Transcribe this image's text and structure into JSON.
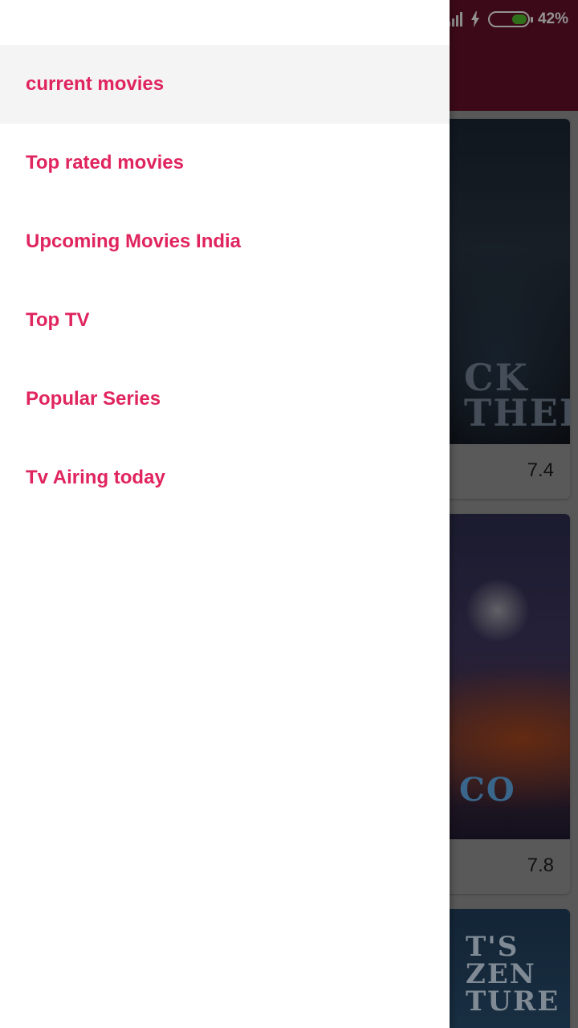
{
  "status_bar": {
    "battery_text": "42%",
    "battery_level": 0.42,
    "icons": [
      "signal-icon",
      "charging-icon",
      "battery-icon"
    ]
  },
  "drawer": {
    "items": [
      {
        "label": "current movies",
        "selected": true
      },
      {
        "label": "Top rated movies",
        "selected": false
      },
      {
        "label": "Upcoming Movies India",
        "selected": false
      },
      {
        "label": "Top TV",
        "selected": false
      },
      {
        "label": "Popular Series",
        "selected": false
      },
      {
        "label": "Tv Airing today",
        "selected": false
      }
    ]
  },
  "content": {
    "cards": [
      {
        "poster_text": "CK\nTHER",
        "rating": "7.4"
      },
      {
        "poster_text": "CO",
        "rating": "7.8"
      },
      {
        "poster_text": "T'S\nZEN\nTURE",
        "rating": ""
      }
    ]
  },
  "colors": {
    "accent": "#e0245e",
    "app_bar": "#5e0f28",
    "battery_fill": "#4caf2a"
  }
}
